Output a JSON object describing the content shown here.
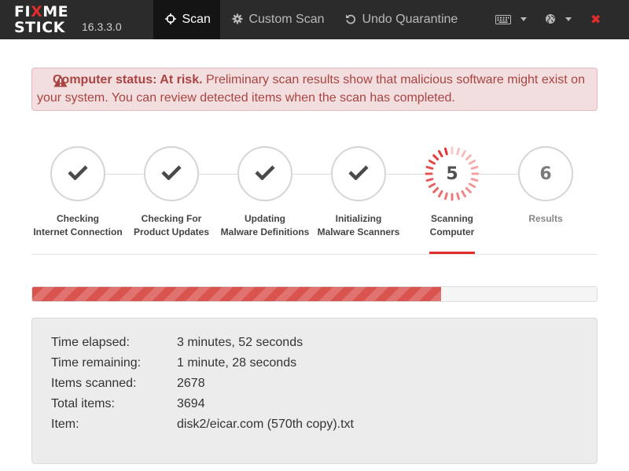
{
  "app": {
    "logo_line1_a": "FI",
    "logo_line1_x": "X",
    "logo_line1_b": "ME",
    "logo_line2": "STICK",
    "version": "16.3.3.0"
  },
  "nav": {
    "scan": "Scan",
    "custom_scan": "Custom Scan",
    "undo_quarantine": "Undo Quarantine",
    "keyboard_icon": "keyboard-icon",
    "globe_icon": "globe-icon",
    "close_glyph": "✖"
  },
  "alert": {
    "title": "Computer status: At risk.",
    "message_line1": "Preliminary scan results show that malicious software might exist on",
    "message_line2": "your system. You can review detected items when the scan has completed."
  },
  "steps": [
    {
      "id": "1",
      "line1": "Checking",
      "line2": "Internet Connection",
      "state": "done"
    },
    {
      "id": "2",
      "line1": "Checking For",
      "line2": "Product Updates",
      "state": "done"
    },
    {
      "id": "3",
      "line1": "Updating",
      "line2": "Malware Definitions",
      "state": "done"
    },
    {
      "id": "4",
      "line1": "Initializing",
      "line2": "Malware Scanners",
      "state": "done"
    },
    {
      "id": "5",
      "line1": "Scanning",
      "line2": "Computer",
      "state": "active"
    },
    {
      "id": "6",
      "line1": "Results",
      "line2": "",
      "state": "pending"
    }
  ],
  "progress": {
    "fraction": 0.724
  },
  "info": {
    "time_elapsed_label": "Time elapsed:",
    "time_elapsed": "3 minutes, 52 seconds",
    "time_remaining_label": "Time remaining:",
    "time_remaining": "1 minute, 28 seconds",
    "items_scanned_label": "Items scanned:",
    "items_scanned": "2678",
    "total_items_label": "Total items:",
    "total_items": "3694",
    "item_label": "Item:",
    "item": "disk2/eicar.com (570th copy).txt"
  },
  "colors": {
    "accent": "#e22d2d",
    "navbar": "#2b2b2b",
    "alert_bg": "#f2dede",
    "alert_text": "#a94442",
    "progress": "#d9534f"
  }
}
